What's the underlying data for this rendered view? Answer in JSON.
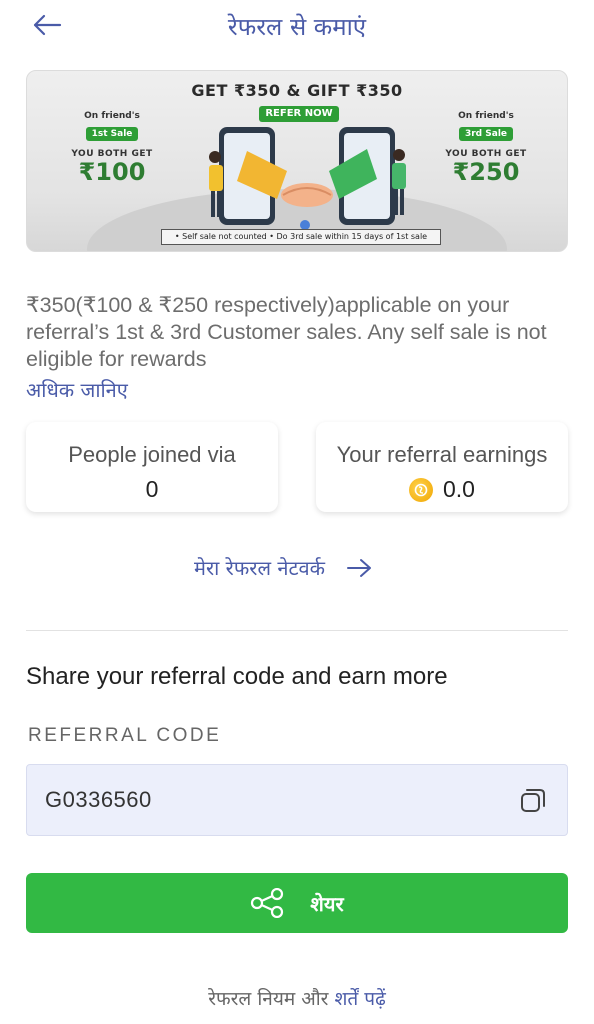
{
  "header": {
    "title": "रेफरल से कमाएं",
    "back_icon": "arrow-left-icon"
  },
  "banner": {
    "headline": "GET ₹350 & GIFT ₹350",
    "refer_now": "REFER NOW",
    "left": {
      "top_text": "On friend's",
      "badge": "1st Sale",
      "both_get": "YOU BOTH GET",
      "amount": "₹100"
    },
    "right": {
      "top_text": "On friend's",
      "badge": "3rd Sale",
      "both_get": "YOU BOTH GET",
      "amount": "₹250"
    },
    "footer_note": "• Self sale not counted • Do 3rd sale within 15 days of 1st sale"
  },
  "description": "₹350(₹100 & ₹250 respectively)applicable on your referral’s 1st & 3rd Customer sales. Any self sale is not eligible for rewards",
  "learn_more": "अधिक जानिए",
  "stats": {
    "people_joined": {
      "label": "People joined via",
      "value": "0"
    },
    "earnings": {
      "label": "Your referral earnings",
      "value": "0.0",
      "icon": "coin-icon"
    }
  },
  "network_link": {
    "label": "मेरा रेफरल नेटवर्क",
    "icon": "arrow-right-icon"
  },
  "share_section": {
    "heading": "Share your referral code and earn more",
    "code_label": "REFERRAL CODE",
    "code_value": "G0336560",
    "copy_icon": "copy-icon"
  },
  "share_button": {
    "label": "शेयर",
    "icon": "share-icon"
  },
  "terms": {
    "prefix": "रेफरल नियम और ",
    "link": "शर्तें पढ़ें"
  },
  "colors": {
    "accent_blue": "#4a5ba8",
    "share_green": "#32b944",
    "code_field_bg": "#eceffb",
    "banner_green": "#2e9e36"
  }
}
